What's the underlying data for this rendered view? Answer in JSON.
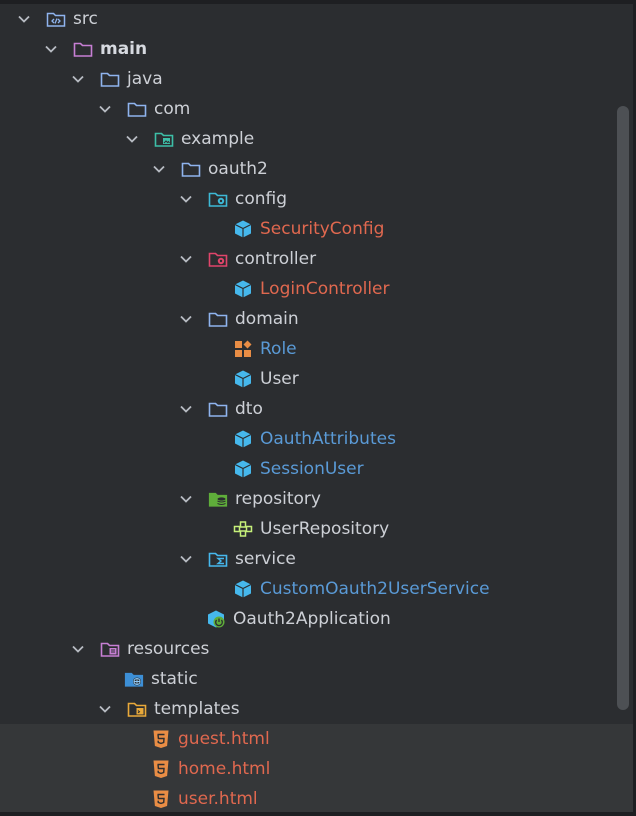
{
  "tree": {
    "rows": [
      {
        "label": "src",
        "icon": "source-folder-icon",
        "expanded": true
      },
      {
        "label": "main",
        "icon": "folder-icon",
        "expanded": true
      },
      {
        "label": "java",
        "icon": "folder-icon",
        "expanded": true
      },
      {
        "label": "com",
        "icon": "folder-icon",
        "expanded": true
      },
      {
        "label": "example",
        "icon": "package-image-folder-icon",
        "expanded": true
      },
      {
        "label": "oauth2",
        "icon": "folder-icon",
        "expanded": true
      },
      {
        "label": "config",
        "icon": "config-folder-icon",
        "expanded": true
      },
      {
        "label": "SecurityConfig",
        "icon": "java-class-icon"
      },
      {
        "label": "controller",
        "icon": "controller-folder-icon",
        "expanded": true
      },
      {
        "label": "LoginController",
        "icon": "java-class-icon"
      },
      {
        "label": "domain",
        "icon": "folder-icon",
        "expanded": true
      },
      {
        "label": "Role",
        "icon": "java-enum-icon"
      },
      {
        "label": "User",
        "icon": "java-class-icon"
      },
      {
        "label": "dto",
        "icon": "folder-icon",
        "expanded": true
      },
      {
        "label": "OauthAttributes",
        "icon": "java-class-icon"
      },
      {
        "label": "SessionUser",
        "icon": "java-class-icon"
      },
      {
        "label": "repository",
        "icon": "database-folder-icon",
        "expanded": true
      },
      {
        "label": "UserRepository",
        "icon": "java-interface-icon"
      },
      {
        "label": "service",
        "icon": "service-folder-icon",
        "expanded": true
      },
      {
        "label": "CustomOauth2UserService",
        "icon": "java-class-icon"
      },
      {
        "label": "Oauth2Application",
        "icon": "spring-app-icon"
      },
      {
        "label": "resources",
        "icon": "resources-folder-icon",
        "expanded": true
      },
      {
        "label": "static",
        "icon": "web-folder-icon"
      },
      {
        "label": "templates",
        "icon": "templates-folder-icon",
        "expanded": true
      },
      {
        "label": "guest.html",
        "icon": "html5-icon"
      },
      {
        "label": "home.html",
        "icon": "html5-icon"
      },
      {
        "label": "user.html",
        "icon": "html5-icon"
      }
    ]
  },
  "colors": {
    "background": "#2b2d30",
    "text_default": "#cdd0d6",
    "text_modified": "#e0684f",
    "text_added": "#5a9ad6",
    "folder_stroke": "#8fb4ee",
    "class_icon": "#46b8ed",
    "selection": "#353739"
  }
}
